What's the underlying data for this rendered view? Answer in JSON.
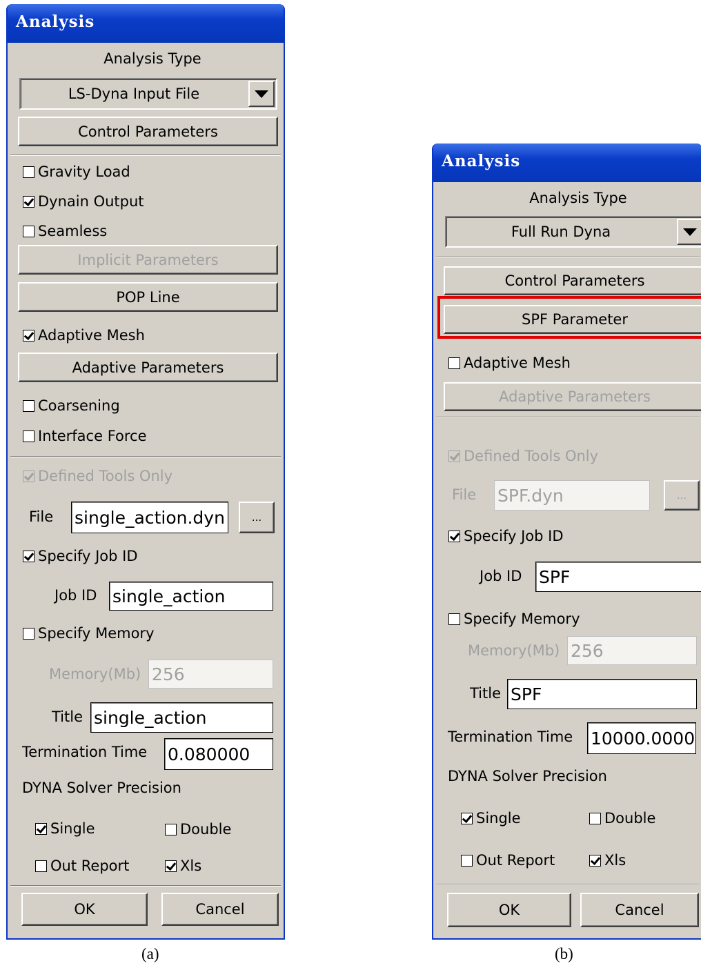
{
  "panel_a": {
    "title": "Analysis",
    "analysis_type_label": "Analysis Type",
    "analysis_type_value": "LS-Dyna Input File",
    "control_parameters": "Control Parameters",
    "gravity_load": "Gravity Load",
    "dynain_output": "Dynain Output",
    "seamless": "Seamless",
    "implicit_parameters": "Implicit Parameters",
    "pop_line": "POP Line",
    "adaptive_mesh": "Adaptive Mesh",
    "adaptive_parameters": "Adaptive Parameters",
    "coarsening": "Coarsening",
    "interface_force": "Interface Force",
    "defined_tools_only": "Defined Tools  Only",
    "file_label": "File",
    "file_value": "single_action.dyn",
    "browse": "...",
    "specify_job_id": "Specify Job ID",
    "job_id_label": "Job ID",
    "job_id_value": "single_action",
    "specify_memory": "Specify Memory",
    "memory_label": "Memory(Mb)",
    "memory_value": "256",
    "title_label": "Title",
    "title_value": "single_action",
    "termination_label": "Termination Time",
    "termination_value": "0.080000",
    "precision_label": "DYNA Solver Precision",
    "single": "Single",
    "double": "Double",
    "out_report": "Out Report",
    "xls": "Xls",
    "ok": "OK",
    "cancel": "Cancel",
    "checked": {
      "gravity_load": false,
      "dynain_output": true,
      "seamless": false,
      "adaptive_mesh": true,
      "coarsening": false,
      "interface_force": false,
      "defined_tools_only": true,
      "specify_job_id": true,
      "specify_memory": false,
      "single": true,
      "double": false,
      "out_report": false,
      "xls": true
    }
  },
  "panel_b": {
    "title": "Analysis",
    "analysis_type_label": "Analysis Type",
    "analysis_type_value": "Full Run Dyna",
    "control_parameters": "Control Parameters",
    "spf_parameter": "SPF Parameter",
    "adaptive_mesh": "Adaptive Mesh",
    "adaptive_parameters": "Adaptive Parameters",
    "defined_tools_only": "Defined Tools  Only",
    "file_label": "File",
    "file_value": "SPF.dyn",
    "browse": "...",
    "specify_job_id": "Specify Job ID",
    "job_id_label": "Job ID",
    "job_id_value": "SPF",
    "specify_memory": "Specify Memory",
    "memory_label": "Memory(Mb)",
    "memory_value": "256",
    "title_label": "Title",
    "title_value": "SPF",
    "termination_label": "Termination Time",
    "termination_value": "10000.0000",
    "precision_label": "DYNA Solver Precision",
    "single": "Single",
    "double": "Double",
    "out_report": "Out Report",
    "xls": "Xls",
    "ok": "OK",
    "cancel": "Cancel",
    "checked": {
      "adaptive_mesh": false,
      "defined_tools_only": true,
      "specify_job_id": true,
      "specify_memory": false,
      "single": true,
      "double": false,
      "out_report": false,
      "xls": true
    },
    "highlight_color": "#e00000"
  },
  "captions": {
    "a": "(a)",
    "b": "(b)"
  }
}
